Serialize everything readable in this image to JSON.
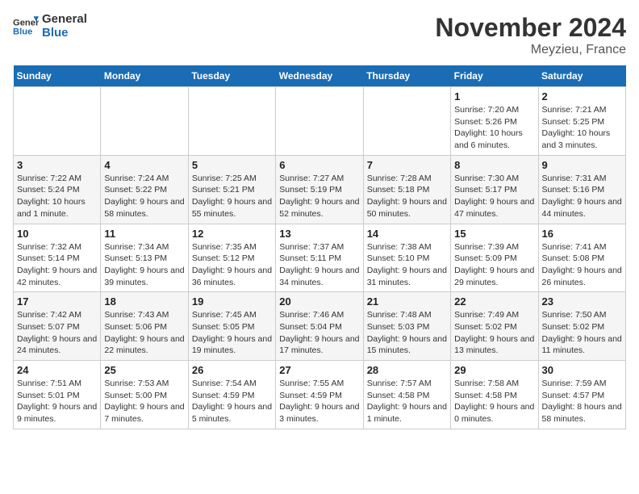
{
  "logo": {
    "line1": "General",
    "line2": "Blue"
  },
  "title": "November 2024",
  "subtitle": "Meyzieu, France",
  "weekdays": [
    "Sunday",
    "Monday",
    "Tuesday",
    "Wednesday",
    "Thursday",
    "Friday",
    "Saturday"
  ],
  "weeks": [
    [
      {
        "day": "",
        "info": ""
      },
      {
        "day": "",
        "info": ""
      },
      {
        "day": "",
        "info": ""
      },
      {
        "day": "",
        "info": ""
      },
      {
        "day": "",
        "info": ""
      },
      {
        "day": "1",
        "info": "Sunrise: 7:20 AM\nSunset: 5:26 PM\nDaylight: 10 hours and 6 minutes."
      },
      {
        "day": "2",
        "info": "Sunrise: 7:21 AM\nSunset: 5:25 PM\nDaylight: 10 hours and 3 minutes."
      }
    ],
    [
      {
        "day": "3",
        "info": "Sunrise: 7:22 AM\nSunset: 5:24 PM\nDaylight: 10 hours and 1 minute."
      },
      {
        "day": "4",
        "info": "Sunrise: 7:24 AM\nSunset: 5:22 PM\nDaylight: 9 hours and 58 minutes."
      },
      {
        "day": "5",
        "info": "Sunrise: 7:25 AM\nSunset: 5:21 PM\nDaylight: 9 hours and 55 minutes."
      },
      {
        "day": "6",
        "info": "Sunrise: 7:27 AM\nSunset: 5:19 PM\nDaylight: 9 hours and 52 minutes."
      },
      {
        "day": "7",
        "info": "Sunrise: 7:28 AM\nSunset: 5:18 PM\nDaylight: 9 hours and 50 minutes."
      },
      {
        "day": "8",
        "info": "Sunrise: 7:30 AM\nSunset: 5:17 PM\nDaylight: 9 hours and 47 minutes."
      },
      {
        "day": "9",
        "info": "Sunrise: 7:31 AM\nSunset: 5:16 PM\nDaylight: 9 hours and 44 minutes."
      }
    ],
    [
      {
        "day": "10",
        "info": "Sunrise: 7:32 AM\nSunset: 5:14 PM\nDaylight: 9 hours and 42 minutes."
      },
      {
        "day": "11",
        "info": "Sunrise: 7:34 AM\nSunset: 5:13 PM\nDaylight: 9 hours and 39 minutes."
      },
      {
        "day": "12",
        "info": "Sunrise: 7:35 AM\nSunset: 5:12 PM\nDaylight: 9 hours and 36 minutes."
      },
      {
        "day": "13",
        "info": "Sunrise: 7:37 AM\nSunset: 5:11 PM\nDaylight: 9 hours and 34 minutes."
      },
      {
        "day": "14",
        "info": "Sunrise: 7:38 AM\nSunset: 5:10 PM\nDaylight: 9 hours and 31 minutes."
      },
      {
        "day": "15",
        "info": "Sunrise: 7:39 AM\nSunset: 5:09 PM\nDaylight: 9 hours and 29 minutes."
      },
      {
        "day": "16",
        "info": "Sunrise: 7:41 AM\nSunset: 5:08 PM\nDaylight: 9 hours and 26 minutes."
      }
    ],
    [
      {
        "day": "17",
        "info": "Sunrise: 7:42 AM\nSunset: 5:07 PM\nDaylight: 9 hours and 24 minutes."
      },
      {
        "day": "18",
        "info": "Sunrise: 7:43 AM\nSunset: 5:06 PM\nDaylight: 9 hours and 22 minutes."
      },
      {
        "day": "19",
        "info": "Sunrise: 7:45 AM\nSunset: 5:05 PM\nDaylight: 9 hours and 19 minutes."
      },
      {
        "day": "20",
        "info": "Sunrise: 7:46 AM\nSunset: 5:04 PM\nDaylight: 9 hours and 17 minutes."
      },
      {
        "day": "21",
        "info": "Sunrise: 7:48 AM\nSunset: 5:03 PM\nDaylight: 9 hours and 15 minutes."
      },
      {
        "day": "22",
        "info": "Sunrise: 7:49 AM\nSunset: 5:02 PM\nDaylight: 9 hours and 13 minutes."
      },
      {
        "day": "23",
        "info": "Sunrise: 7:50 AM\nSunset: 5:02 PM\nDaylight: 9 hours and 11 minutes."
      }
    ],
    [
      {
        "day": "24",
        "info": "Sunrise: 7:51 AM\nSunset: 5:01 PM\nDaylight: 9 hours and 9 minutes."
      },
      {
        "day": "25",
        "info": "Sunrise: 7:53 AM\nSunset: 5:00 PM\nDaylight: 9 hours and 7 minutes."
      },
      {
        "day": "26",
        "info": "Sunrise: 7:54 AM\nSunset: 4:59 PM\nDaylight: 9 hours and 5 minutes."
      },
      {
        "day": "27",
        "info": "Sunrise: 7:55 AM\nSunset: 4:59 PM\nDaylight: 9 hours and 3 minutes."
      },
      {
        "day": "28",
        "info": "Sunrise: 7:57 AM\nSunset: 4:58 PM\nDaylight: 9 hours and 1 minute."
      },
      {
        "day": "29",
        "info": "Sunrise: 7:58 AM\nSunset: 4:58 PM\nDaylight: 9 hours and 0 minutes."
      },
      {
        "day": "30",
        "info": "Sunrise: 7:59 AM\nSunset: 4:57 PM\nDaylight: 8 hours and 58 minutes."
      }
    ]
  ]
}
